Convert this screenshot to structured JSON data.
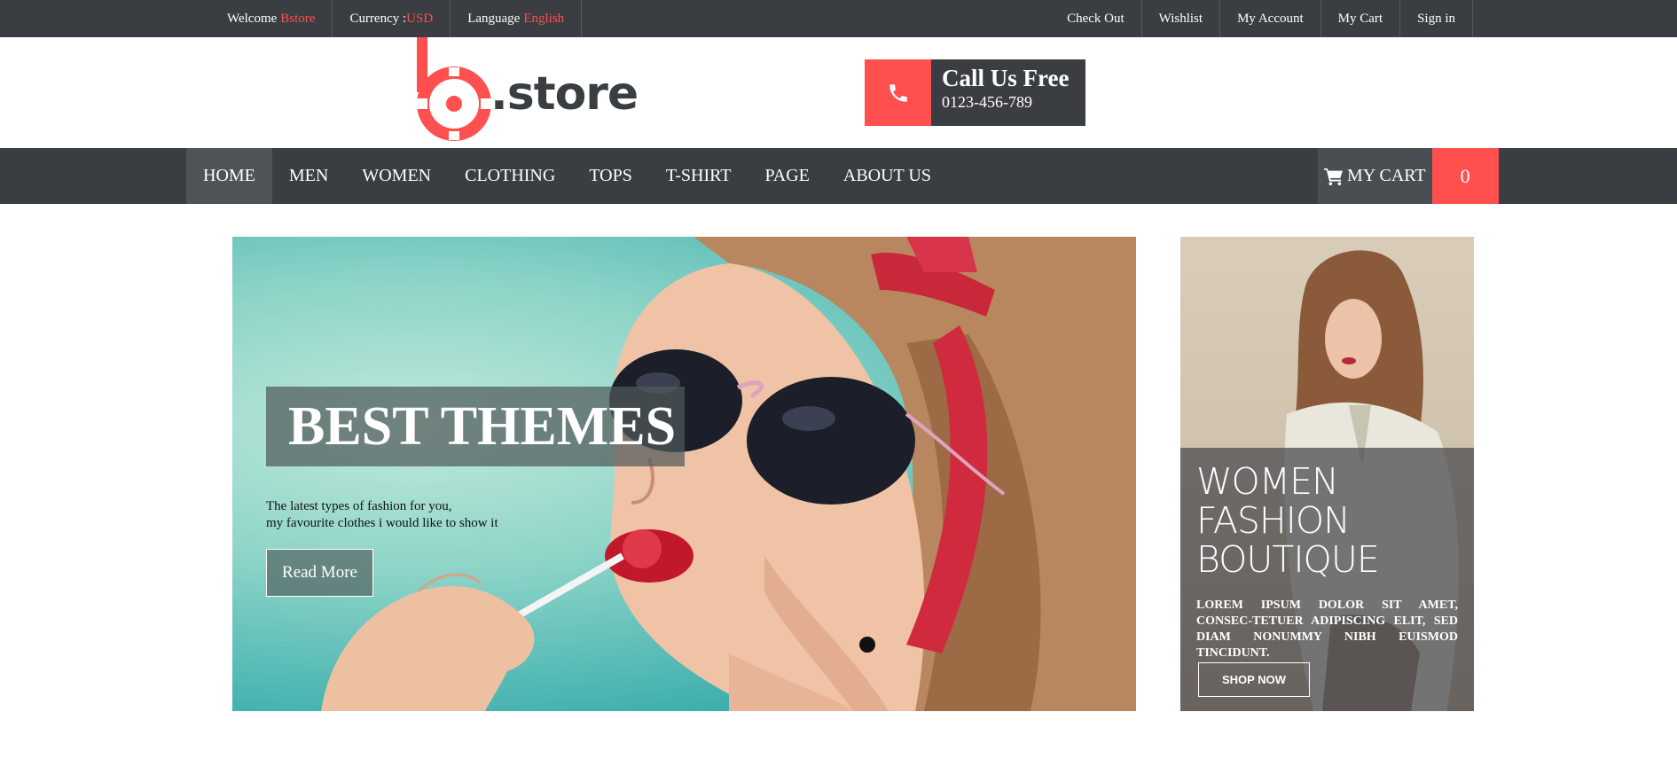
{
  "topbar": {
    "welcome_label": "Welcome",
    "welcome_value": "Bstore",
    "currency_label": "Currency :",
    "currency_value": "USD",
    "language_label": "Language",
    "language_value": "English",
    "links": [
      "Check Out",
      "Wishlist",
      "My Account",
      "My Cart",
      "Sign in"
    ]
  },
  "header": {
    "logo_text": ".store",
    "call_title": "Call Us Free",
    "call_phone": "0123-456-789"
  },
  "nav": {
    "items": [
      "HOME",
      "MEN",
      "WOMEN",
      "CLOTHING",
      "TOPS",
      "T-SHIRT",
      "PAGE",
      "ABOUT US"
    ],
    "active_item": "HOME",
    "cart_label": "MY CART",
    "cart_count": "0"
  },
  "hero": {
    "title": "BEST THEMES",
    "desc_line1": "The latest types of fashion for you,",
    "desc_line2": "my favourite clothes i would like to show it",
    "button_label": "Read More"
  },
  "side_banner": {
    "title_line1": "WOMEN",
    "title_line2": "FASHION",
    "title_line3": "BOUTIQUE",
    "text": "LOREM IPSUM DOLOR SIT AMET, CONSEC-TETUER ADIPISCING ELIT, SED DIAM NONUMMY NIBH EUISMOD TINCIDUNT.",
    "button_label": "SHOP NOW"
  },
  "colors": {
    "accent": "#ff4f4f",
    "dark": "#3a3d41"
  },
  "icons": {
    "phone": "phone-icon",
    "cart": "shopping-cart-icon",
    "logo": "bstore-logo-icon"
  }
}
